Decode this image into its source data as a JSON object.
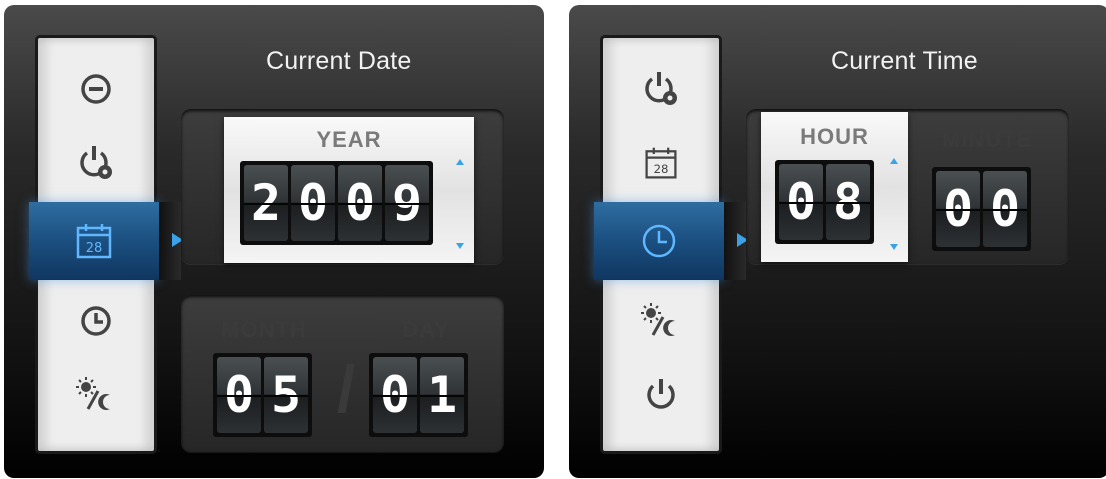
{
  "date_screen": {
    "title": "Current Date",
    "year": {
      "label": "YEAR",
      "value": [
        "2",
        "0",
        "0",
        "9"
      ]
    },
    "month": {
      "label": "MONTH",
      "value": [
        "0",
        "5"
      ]
    },
    "day": {
      "label": "DAY",
      "value": [
        "0",
        "1"
      ]
    },
    "separator": "/",
    "sidebar": [
      "minus-circle-icon",
      "power-settings-icon",
      "calendar-icon",
      "clock-icon",
      "day-night-icon"
    ],
    "active_item": "calendar-icon",
    "calendar_number": "28"
  },
  "time_screen": {
    "title": "Current Time",
    "hour": {
      "label": "HOUR",
      "value": [
        "0",
        "8"
      ]
    },
    "minute": {
      "label": "MINUTE",
      "value": [
        "0",
        "0"
      ]
    },
    "sidebar": [
      "power-settings-icon",
      "calendar-icon",
      "clock-icon",
      "day-night-icon",
      "power-icon"
    ],
    "active_item": "clock-icon",
    "calendar_number": "28"
  },
  "colors": {
    "accent": "#3aa3e8",
    "active_tile": "#1b4f80"
  }
}
